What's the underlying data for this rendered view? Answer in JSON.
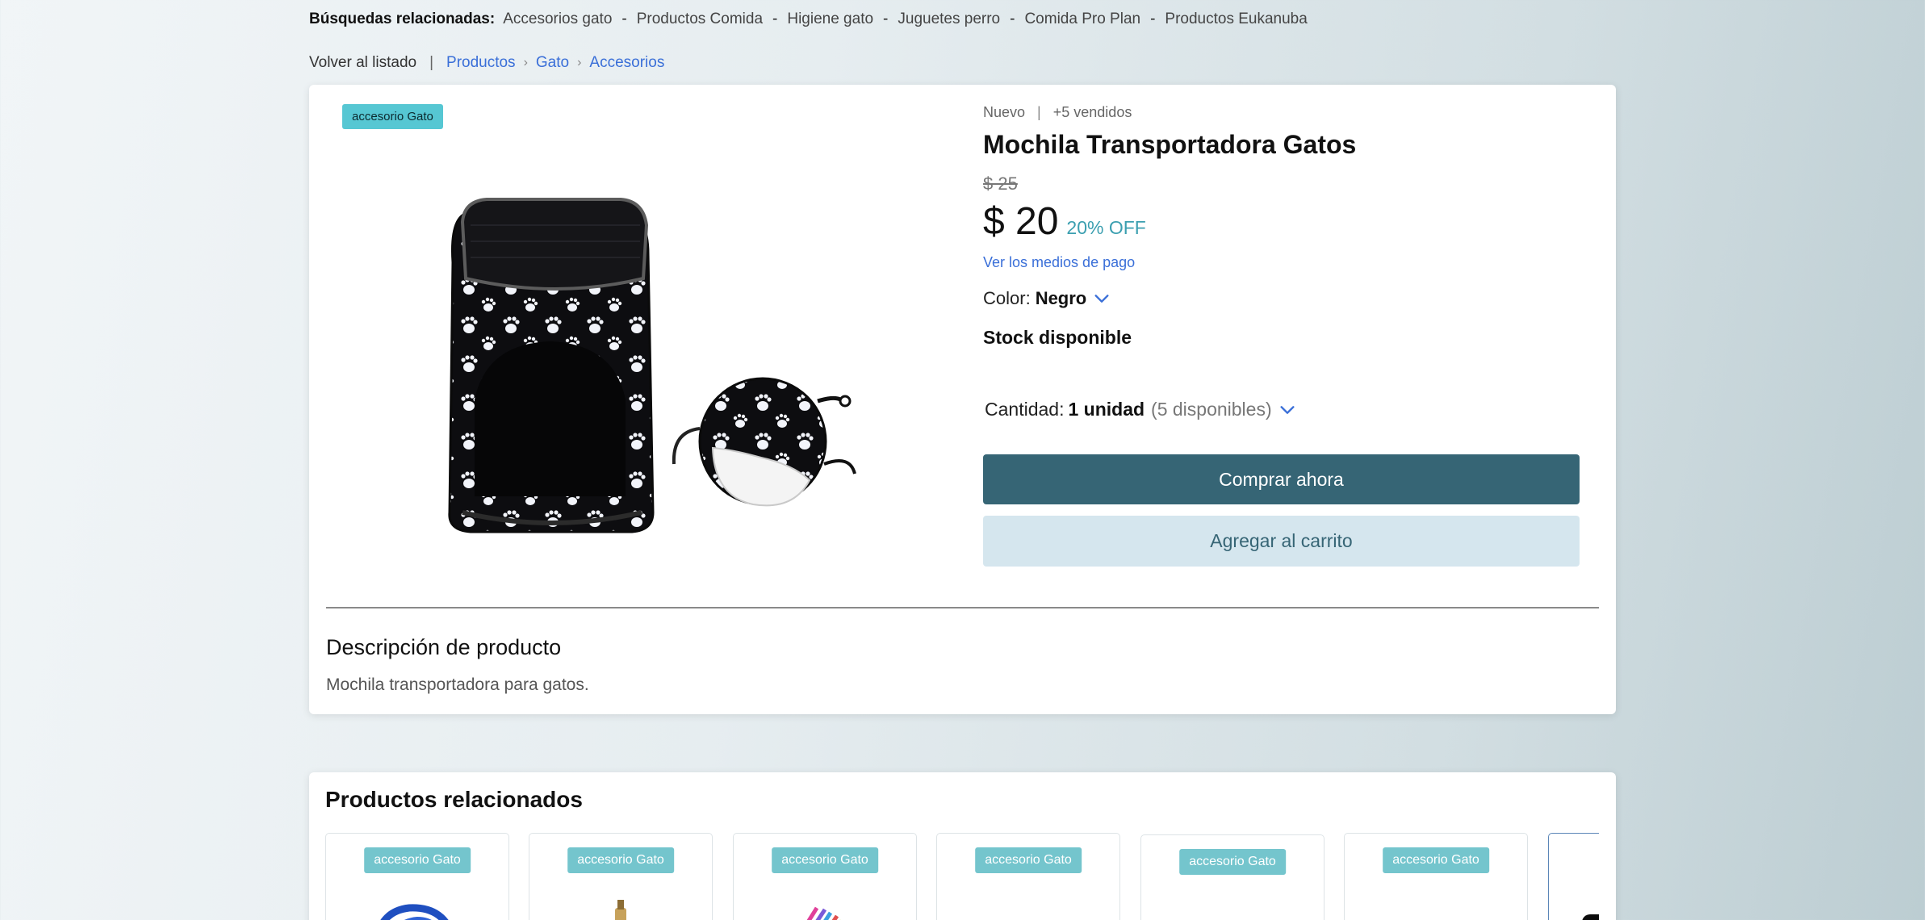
{
  "related_searches": {
    "title": "Búsquedas relacionadas:",
    "links": [
      "Accesorios gato",
      "Productos Comida",
      "Higiene gato",
      "Juguetes perro",
      "Comida Pro Plan",
      "Productos Eukanuba"
    ],
    "separator": "-"
  },
  "breadcrumb": {
    "back_label": "Volver al listado",
    "divider": "|",
    "items": [
      "Productos",
      "Gato",
      "Accesorios"
    ]
  },
  "product": {
    "badge": "accesorio Gato",
    "condition": "Nuevo",
    "meta_separator": "|",
    "sold": "+5 vendidos",
    "title": "Mochila Transportadora Gatos",
    "old_price": "$ 25",
    "price": "$ 20",
    "discount": "20% OFF",
    "payment_link": "Ver los medios de pago",
    "color_label": "Color:",
    "color_value": "Negro",
    "stock": "Stock disponible",
    "quantity_label": "Cantidad:",
    "quantity_value": "1 unidad",
    "quantity_available": "(5 disponibles)",
    "buy_button": "Comprar ahora",
    "cart_button": "Agregar al carrito",
    "image_icon": "cat-carrier-backpack-image"
  },
  "description": {
    "title": "Descripción de producto",
    "text": "Mochila transportadora para gatos."
  },
  "related": {
    "title": "Productos relacionados",
    "items": [
      {
        "badge": "accesorio Gato",
        "icon": "leash-thumbnail"
      },
      {
        "badge": "accesorio Gato",
        "icon": "bottle-thumbnail"
      },
      {
        "badge": "accesorio Gato",
        "icon": "collar-thumbnail"
      },
      {
        "badge": "accesorio Gato",
        "icon": "blank-thumbnail"
      },
      {
        "badge": "accesorio Gato",
        "icon": "bowl-thumbnail"
      },
      {
        "badge": "accesorio Gato",
        "icon": "fountain-thumbnail"
      },
      {
        "badge": "",
        "icon": "dark-product-thumbnail"
      }
    ]
  },
  "colors": {
    "accent_blue": "#3a6fd8",
    "badge_teal": "#56c7d3",
    "buy_button": "#366575",
    "cart_button": "#d5e6ee",
    "discount": "#3b9fb0"
  }
}
